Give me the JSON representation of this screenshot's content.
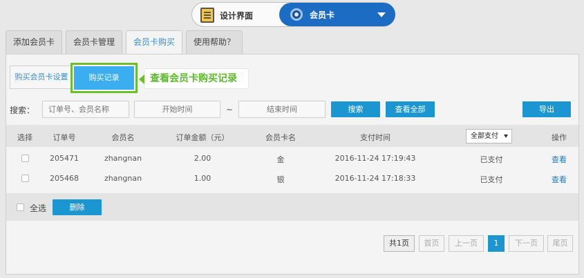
{
  "switcher": {
    "design_label": "设计界面",
    "member_label": "会员卡"
  },
  "tabs": [
    {
      "label": "添加会员卡"
    },
    {
      "label": "会员卡管理"
    },
    {
      "label": "会员卡购买"
    },
    {
      "label": "使用帮助？"
    }
  ],
  "subtabs": {
    "settings": "购买会员卡设置",
    "records": "购买记录"
  },
  "callout": "查看会员卡购买记录",
  "search": {
    "label": "搜索：",
    "order_placeholder": "订单号、会员名称",
    "start_placeholder": "开始时间",
    "separator": "~",
    "end_placeholder": "结束时间",
    "search_button": "搜索",
    "view_all_button": "查看全部",
    "export_button": "导出"
  },
  "table": {
    "headers": [
      "选择",
      "订单号",
      "会员名",
      "订单金额（元）",
      "会员卡名",
      "支付时间",
      "操作"
    ],
    "pay_filter": "全部支付",
    "rows": [
      {
        "order": "205471",
        "member": "zhangnan",
        "amount": "2.00",
        "card": "金",
        "time": "2016-11-24 17:19:43",
        "status": "已支付",
        "action": "查看"
      },
      {
        "order": "205468",
        "member": "zhangnan",
        "amount": "1.00",
        "card": "银",
        "time": "2016-11-24 17:18:33",
        "status": "已支付",
        "action": "查看"
      }
    ]
  },
  "bulk": {
    "select_all": "全选",
    "delete_button": "删除"
  },
  "pagination": {
    "total": "共1页",
    "first": "首页",
    "prev": "上一页",
    "current": "1",
    "next": "下一页",
    "last": "尾页"
  },
  "colors": {
    "accent": "#1c96d1",
    "highlight": "#6abf2c",
    "switcher_active": "#1d6cc4"
  }
}
